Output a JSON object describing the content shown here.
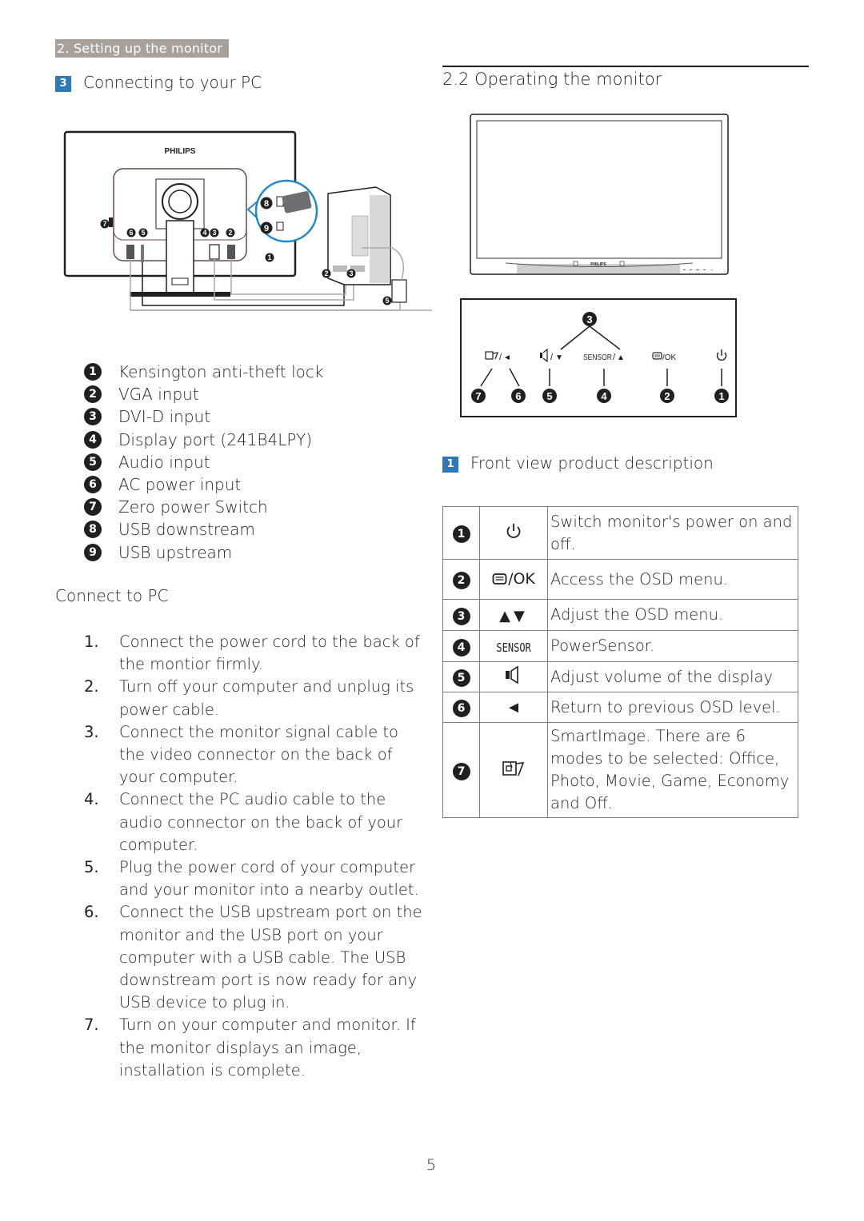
{
  "header": {
    "chapter_tag": "2. Setting up the monitor"
  },
  "connecting": {
    "badge": "3",
    "title": "Connecting to your PC",
    "diagram": {
      "brand": "PHILIPS",
      "callouts": [
        "1",
        "2",
        "3",
        "4",
        "5",
        "6",
        "7",
        "8",
        "9"
      ]
    },
    "legend": [
      {
        "num": "1",
        "label": "Kensington anti-theft lock"
      },
      {
        "num": "2",
        "label": "VGA input"
      },
      {
        "num": "3",
        "label": "DVI-D input"
      },
      {
        "num": "4",
        "label": "Display port (241B4LPY)"
      },
      {
        "num": "5",
        "label": "Audio input"
      },
      {
        "num": "6",
        "label": "AC power input"
      },
      {
        "num": "7",
        "label": "Zero power Switch"
      },
      {
        "num": "8",
        "label": "USB downstream"
      },
      {
        "num": "9",
        "label": "USB upstream"
      }
    ],
    "connect_title": "Connect to PC",
    "steps": [
      {
        "num": "1.",
        "text": "Connect the power cord to the back of the montior firmly."
      },
      {
        "num": "2.",
        "text": "Turn off your computer and unplug its power cable."
      },
      {
        "num": "3.",
        "text": "Connect the monitor signal cable to the video connector on the back of your computer."
      },
      {
        "num": "4.",
        "text": "Connect the PC audio cable to the audio connector on the back of your computer."
      },
      {
        "num": "5.",
        "text": "Plug the power cord of your computer and your monitor into a nearby outlet."
      },
      {
        "num": "6.",
        "text": "Connect the USB upstream port on the monitor and the USB port on your computer with a USB cable. The USB downstream port is now ready for any USB device to plug in."
      },
      {
        "num": "7.",
        "text": "Turn on your computer and monitor. If the monitor displays an image, installation is complete."
      }
    ]
  },
  "operating": {
    "title": "2.2 Operating the monitor",
    "front_brand": "PHILIPS",
    "panel": {
      "labels": {
        "smartimage_back": "◄",
        "volume_down": "▼",
        "sensor": "SENSOR",
        "up": "▲",
        "ok": "/OK"
      },
      "callouts": [
        "7",
        "6",
        "5",
        "4",
        "2",
        "1",
        "3"
      ]
    },
    "front_view": {
      "badge": "1",
      "title": "Front view product description"
    },
    "table": [
      {
        "num": "1",
        "icon": "power-icon",
        "icon_text": "",
        "desc": "Switch monitor's power on and off."
      },
      {
        "num": "2",
        "icon": "menu-ok-icon",
        "icon_text": "/OK",
        "desc": "Access the OSD menu."
      },
      {
        "num": "3",
        "icon": "up-down-arrows-icon",
        "icon_text": "▲▼",
        "desc": "Adjust the OSD menu."
      },
      {
        "num": "4",
        "icon": "sensor-icon",
        "icon_text": "SENSOR",
        "desc": "PowerSensor."
      },
      {
        "num": "5",
        "icon": "speaker-icon",
        "icon_text": "",
        "desc": "Adjust volume of the display"
      },
      {
        "num": "6",
        "icon": "left-arrow-icon",
        "icon_text": "◄",
        "desc": "Return to previous OSD level."
      },
      {
        "num": "7",
        "icon": "smartimage-icon",
        "icon_text": "",
        "desc": "SmartImage. There are 6 modes to be selected: Office, Photo, Movie, Game, Economy and Off."
      }
    ]
  },
  "footer": {
    "page_number": "5"
  },
  "colors": {
    "tag_bg": "#a7a09b",
    "badge_blue": "#2e7ab8",
    "callout_blue": "#1e88c8",
    "text": "#231f20"
  }
}
